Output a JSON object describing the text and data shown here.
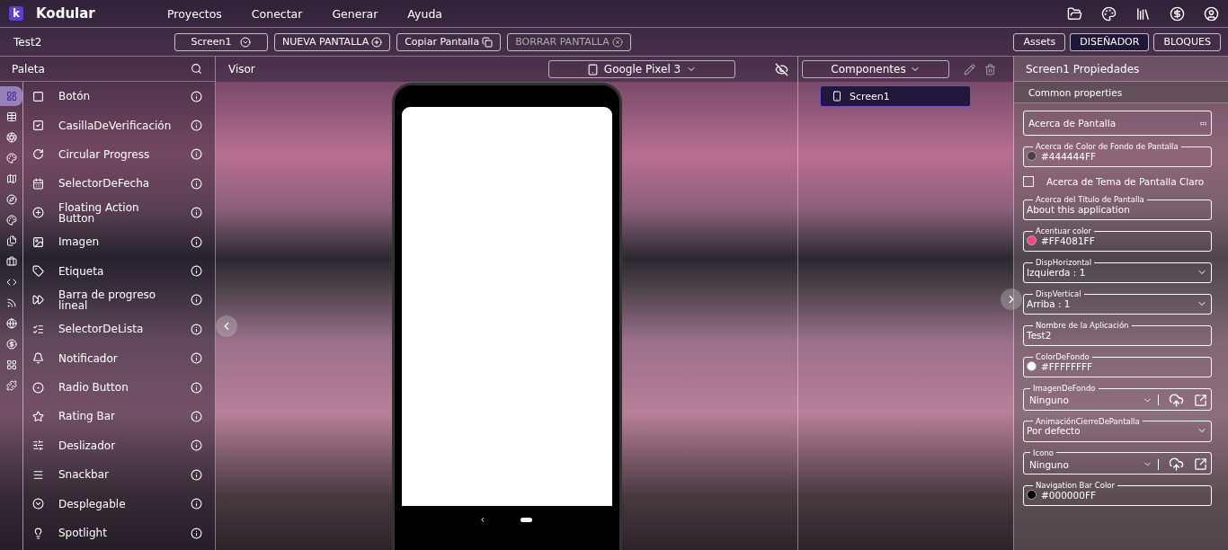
{
  "app": {
    "logo_letter": "k",
    "name": "Kodular"
  },
  "menu": [
    "Proyectos",
    "Conectar",
    "Generar",
    "Ayuda"
  ],
  "project": "Test2",
  "screen_buttons": [
    {
      "label": "Screen1",
      "kind": "dropdown",
      "disabled": false
    },
    {
      "label": "NUEVA PANTALLA",
      "kind": "add",
      "disabled": false
    },
    {
      "label": "Copiar Pantalla",
      "kind": "copy",
      "disabled": false
    },
    {
      "label": "BORRAR PANTALLA",
      "kind": "delete",
      "disabled": true
    }
  ],
  "view_tabs": [
    {
      "label": "Assets",
      "selected": false
    },
    {
      "label": "DISEÑADOR",
      "selected": true
    },
    {
      "label": "BLOQUES",
      "selected": false
    }
  ],
  "palette": {
    "title": "Paleta",
    "categories": [
      {
        "selected": true
      },
      {
        "selected": false
      },
      {
        "selected": false
      },
      {
        "selected": false
      },
      {
        "selected": false
      },
      {
        "selected": false
      },
      {
        "selected": false
      },
      {
        "selected": false
      },
      {
        "selected": false
      },
      {
        "selected": false
      },
      {
        "selected": false
      },
      {
        "selected": false
      },
      {
        "selected": false
      },
      {
        "selected": false
      },
      {
        "selected": false
      }
    ],
    "items": [
      "Botón",
      "CasillaDeVerificación",
      "Circular Progress",
      "SelectorDeFecha",
      "Floating Action Button",
      "Imagen",
      "Etiqueta",
      "Barra de progreso lineal",
      "SelectorDeLista",
      "Notificador",
      "Radio Button",
      "Rating Bar",
      "Deslizador",
      "Snackbar",
      "Desplegable",
      "Spotlight"
    ]
  },
  "viewer": {
    "title": "Visor",
    "device": "Google Pixel 3",
    "nav_back": "‹"
  },
  "components": {
    "title": "Componentes",
    "items": [
      {
        "label": "Screen1",
        "selected": true
      }
    ]
  },
  "properties": {
    "title": "Screen1 Propiedades",
    "section": "Common properties",
    "fields": [
      {
        "kind": "textarea",
        "value": "Acerca de Pantalla"
      },
      {
        "kind": "color",
        "label": "Acerca de Color de Fondo de Pantalla",
        "value": "#444444FF",
        "color": "#444444"
      },
      {
        "kind": "checkbox",
        "label": "Acerca de Tema de Pantalla Claro",
        "checked": false
      },
      {
        "kind": "text",
        "label": "Acerca del Título de Pantalla",
        "value": "About this application"
      },
      {
        "kind": "color",
        "label": "Acentuar color",
        "value": "#FF4081FF",
        "color": "#ff4081"
      },
      {
        "kind": "select",
        "label": "DispHorizontal",
        "value": "Izquierda : 1"
      },
      {
        "kind": "select",
        "label": "DispVertical",
        "value": "Arriba : 1"
      },
      {
        "kind": "text",
        "label": "Nombre de la Aplicación",
        "value": "Test2"
      },
      {
        "kind": "color",
        "label": "ColorDeFondo",
        "value": "#FFFFFFFF",
        "color": "#ffffff"
      },
      {
        "kind": "asset",
        "label": "ImagenDeFondo",
        "value": "Ninguno"
      },
      {
        "kind": "select",
        "label": "AnimaciónCierreDePantalla",
        "value": "Por defecto"
      },
      {
        "kind": "asset",
        "label": "Icono",
        "value": "Ninguno"
      },
      {
        "kind": "color",
        "label": "Navigation Bar Color",
        "value": "#000000FF",
        "color": "#000000"
      }
    ]
  }
}
